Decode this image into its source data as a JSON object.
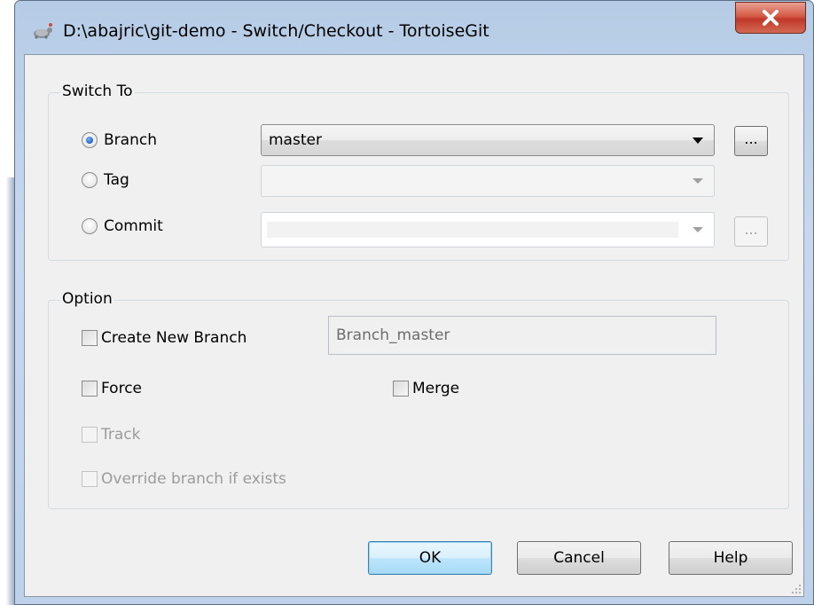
{
  "window": {
    "title": "D:\\abajric\\git-demo - Switch/Checkout - TortoiseGit",
    "close_glyph": "X"
  },
  "switch_to": {
    "label": "Switch To",
    "branch": {
      "label": "Branch",
      "selected": true,
      "value": "master",
      "browse": "..."
    },
    "tag": {
      "label": "Tag",
      "selected": false,
      "value": ""
    },
    "commit": {
      "label": "Commit",
      "selected": false,
      "value": "",
      "browse": "..."
    }
  },
  "option": {
    "label": "Option",
    "create_new_branch": {
      "label": "Create New Branch",
      "checked": false,
      "name_value": "Branch_master"
    },
    "force": {
      "label": "Force",
      "checked": false
    },
    "merge": {
      "label": "Merge",
      "checked": false
    },
    "track": {
      "label": "Track",
      "checked": false,
      "enabled": false
    },
    "override": {
      "label": "Override branch if exists",
      "checked": false,
      "enabled": false
    }
  },
  "buttons": {
    "ok": "OK",
    "cancel": "Cancel",
    "help": "Help"
  },
  "icons": {
    "title": "tortoisegit-icon",
    "close": "close-icon",
    "resize": "resize-grip-icon"
  },
  "colors": {
    "titlebar": "#bdd1ea",
    "close": "#c8432e",
    "default_button": "#bee6fd",
    "dialog_bg": "#f0f0f0"
  }
}
